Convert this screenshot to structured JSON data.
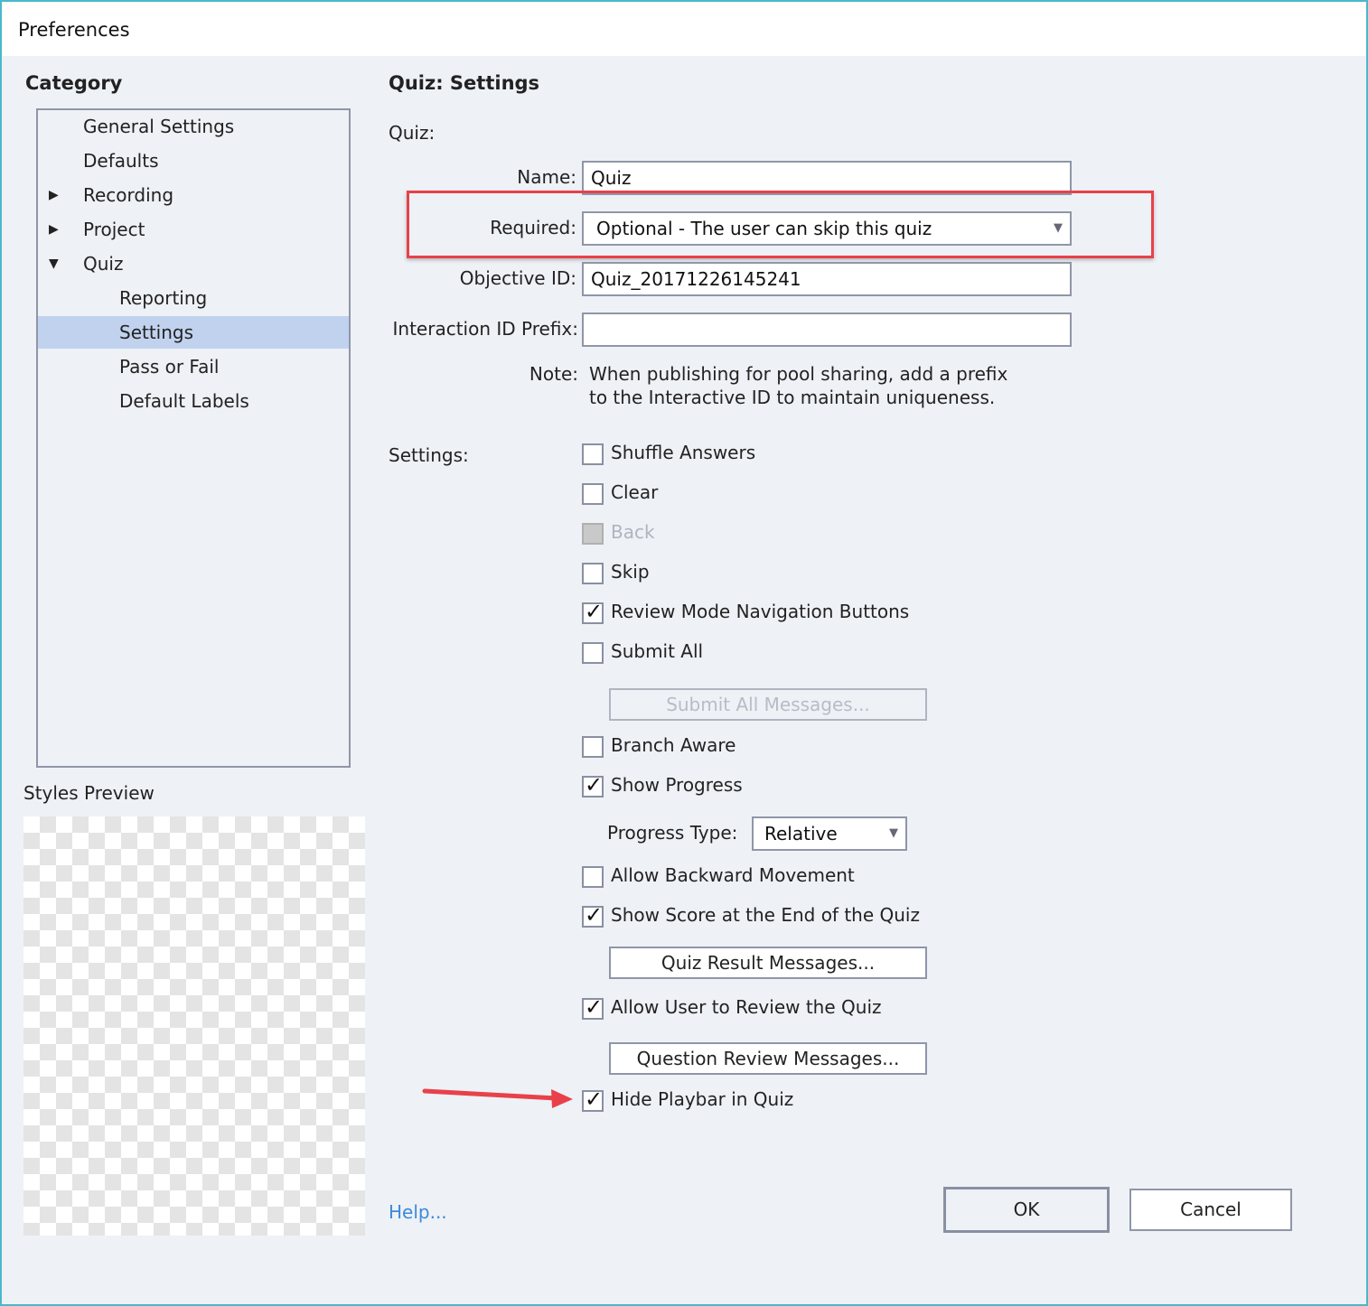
{
  "window": {
    "title": "Preferences"
  },
  "sidebar": {
    "heading": "Category",
    "items": [
      {
        "label": "General Settings",
        "expander": ""
      },
      {
        "label": "Defaults",
        "expander": ""
      },
      {
        "label": "Recording",
        "expander": "▶"
      },
      {
        "label": "Project",
        "expander": "▶"
      },
      {
        "label": "Quiz",
        "expander": "▼"
      },
      {
        "label": "Reporting",
        "expander": ""
      },
      {
        "label": "Settings",
        "expander": "",
        "selected": true
      },
      {
        "label": "Pass or Fail",
        "expander": ""
      },
      {
        "label": "Default Labels",
        "expander": ""
      }
    ],
    "styles_preview": "Styles Preview"
  },
  "main": {
    "heading": "Quiz: Settings",
    "quiz_label": "Quiz:",
    "name": {
      "label": "Name:",
      "value": "Quiz"
    },
    "required": {
      "label": "Required:",
      "value": "Optional - The user can skip this quiz"
    },
    "objective": {
      "label": "Objective ID:",
      "value": "Quiz_20171226145241"
    },
    "prefix": {
      "label": "Interaction ID Prefix:",
      "value": ""
    },
    "note": {
      "label": "Note:",
      "line1": "When publishing for pool sharing, add a prefix",
      "line2": "to the Interactive ID to maintain uniqueness."
    },
    "settings_label": "Settings:",
    "checkboxes": [
      {
        "label": "Shuffle Answers",
        "checked": false
      },
      {
        "label": "Clear",
        "checked": false
      },
      {
        "label": "Back",
        "checked": false,
        "disabled": true
      },
      {
        "label": "Skip",
        "checked": false
      },
      {
        "label": "Review Mode Navigation Buttons",
        "checked": true
      },
      {
        "label": "Submit All",
        "checked": false
      },
      {
        "label": "Branch Aware",
        "checked": false
      },
      {
        "label": "Show Progress",
        "checked": true
      },
      {
        "label": "Allow Backward Movement",
        "checked": false
      },
      {
        "label": "Show Score at the End of the Quiz",
        "checked": true
      },
      {
        "label": "Allow User to Review the Quiz",
        "checked": true
      },
      {
        "label": "Hide Playbar in Quiz",
        "checked": true
      }
    ],
    "submit_all_messages": "Submit All Messages...",
    "progress_type": {
      "label": "Progress Type:",
      "value": "Relative"
    },
    "quiz_result_messages": "Quiz Result Messages...",
    "question_review_messages": "Question Review Messages...",
    "check_mark": "✓",
    "dropdown_arrow": "▼"
  },
  "footer": {
    "help": "Help...",
    "ok": "OK",
    "cancel": "Cancel"
  },
  "annotation_color": "#e8414a"
}
